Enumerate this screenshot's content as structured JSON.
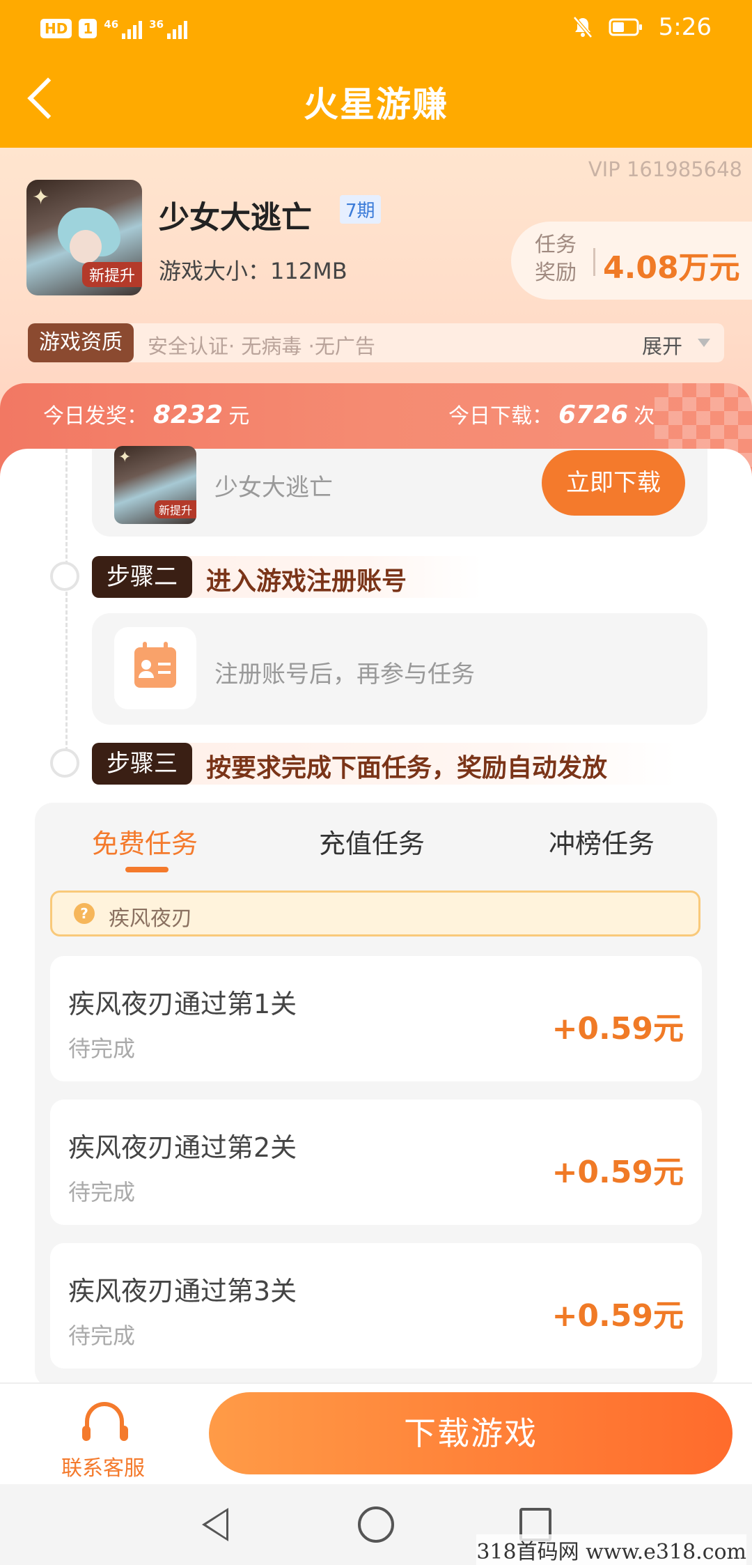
{
  "status_bar": {
    "hd_label": "HD",
    "sim_label": "1",
    "net1": "46",
    "net2": "36",
    "time": "5:26"
  },
  "title_bar": {
    "title": "火星游赚"
  },
  "header": {
    "vip": "VIP 161985648",
    "app_name": "少女大逃亡",
    "period": "7期",
    "size": "游戏大小：112MB",
    "icon_badge": "新提升",
    "reward_label_1": "任务",
    "reward_label_2": "奖励",
    "reward_value": "4.08万元",
    "qual_tag": "游戏资质",
    "qual_text": "安全认证· 无病毒 ·无广告",
    "expand": "展开"
  },
  "stats": {
    "left_label": "今日发奖：",
    "left_value": "8232",
    "left_unit": "元",
    "right_label": "今日下载：",
    "right_value": "6726",
    "right_unit": "次"
  },
  "step1": {
    "app_name": "少女大逃亡",
    "button": "立即下载",
    "icon_badge": "新提升"
  },
  "step2": {
    "tag": "步骤二",
    "title": "进入游戏注册账号",
    "text": "注册账号后，再参与任务"
  },
  "step3": {
    "tag": "步骤三",
    "title": "按要求完成下面任务，奖励自动发放"
  },
  "tabs": [
    "免费任务",
    "充值任务",
    "冲榜任务"
  ],
  "hint": {
    "icon": "?",
    "text": "疾风夜刃"
  },
  "tasks": [
    {
      "name": "疾风夜刃通过第1关",
      "status": "待完成",
      "reward": "+0.59元"
    },
    {
      "name": "疾风夜刃通过第2关",
      "status": "待完成",
      "reward": "+0.59元"
    },
    {
      "name": "疾风夜刃通过第3关",
      "status": "待完成",
      "reward": "+0.59元"
    }
  ],
  "bottom": {
    "service": "联系客服",
    "download": "下载游戏"
  },
  "watermark": "318首码网 www.e318.com",
  "colors": {
    "brand": "#FFAA00",
    "accent": "#F47A2C"
  }
}
